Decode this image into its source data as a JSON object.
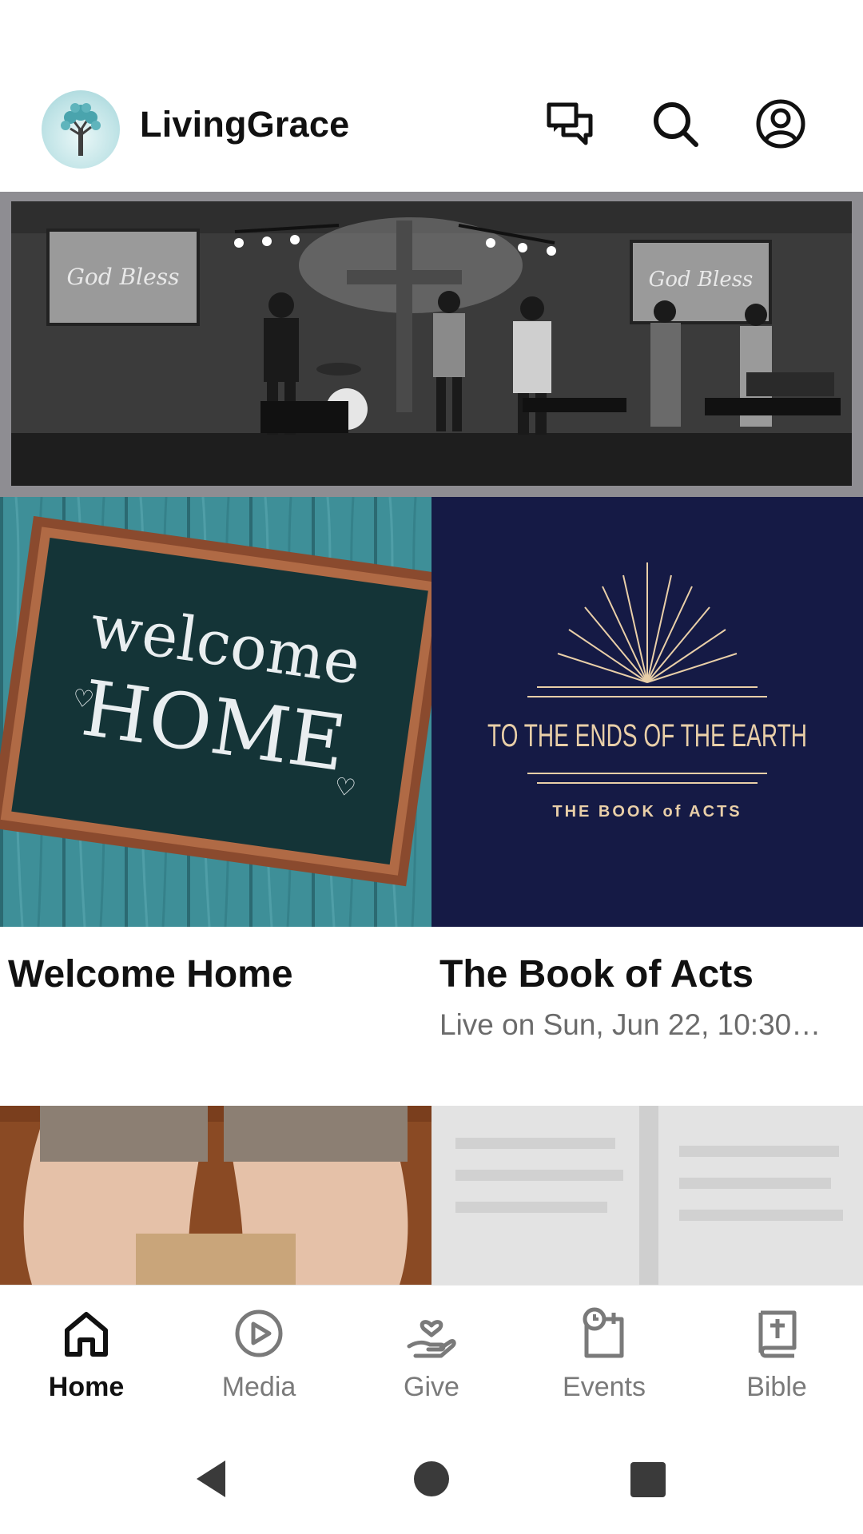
{
  "app": {
    "title": "LivingGrace"
  },
  "header": {
    "icons": [
      "chat-icon",
      "search-icon",
      "profile-icon"
    ]
  },
  "hero": {
    "screen_text": "God Bless"
  },
  "cards": [
    {
      "title": "Welcome Home",
      "subtitle": "",
      "image_text_line1": "welcome",
      "image_text_line2": "HOME"
    },
    {
      "title": "The Book of Acts",
      "subtitle": "Live on Sun, Jun 22, 10:30…",
      "image_text_line1": "TO THE ENDS OF THE EARTH",
      "image_text_line2": "THE BOOK of ACTS"
    }
  ],
  "bottom_nav": {
    "items": [
      {
        "label": "Home",
        "icon": "home-icon",
        "active": true
      },
      {
        "label": "Media",
        "icon": "play-icon",
        "active": false
      },
      {
        "label": "Give",
        "icon": "give-icon",
        "active": false
      },
      {
        "label": "Events",
        "icon": "events-icon",
        "active": false
      },
      {
        "label": "Bible",
        "icon": "bible-icon",
        "active": false
      }
    ]
  },
  "colors": {
    "accent_navy": "#151a45",
    "gold": "#e9cfa8",
    "chalkboard": "#143437",
    "teal_wood": "#3e8f98",
    "text_primary": "#111111",
    "text_secondary": "#6b6b6b"
  }
}
